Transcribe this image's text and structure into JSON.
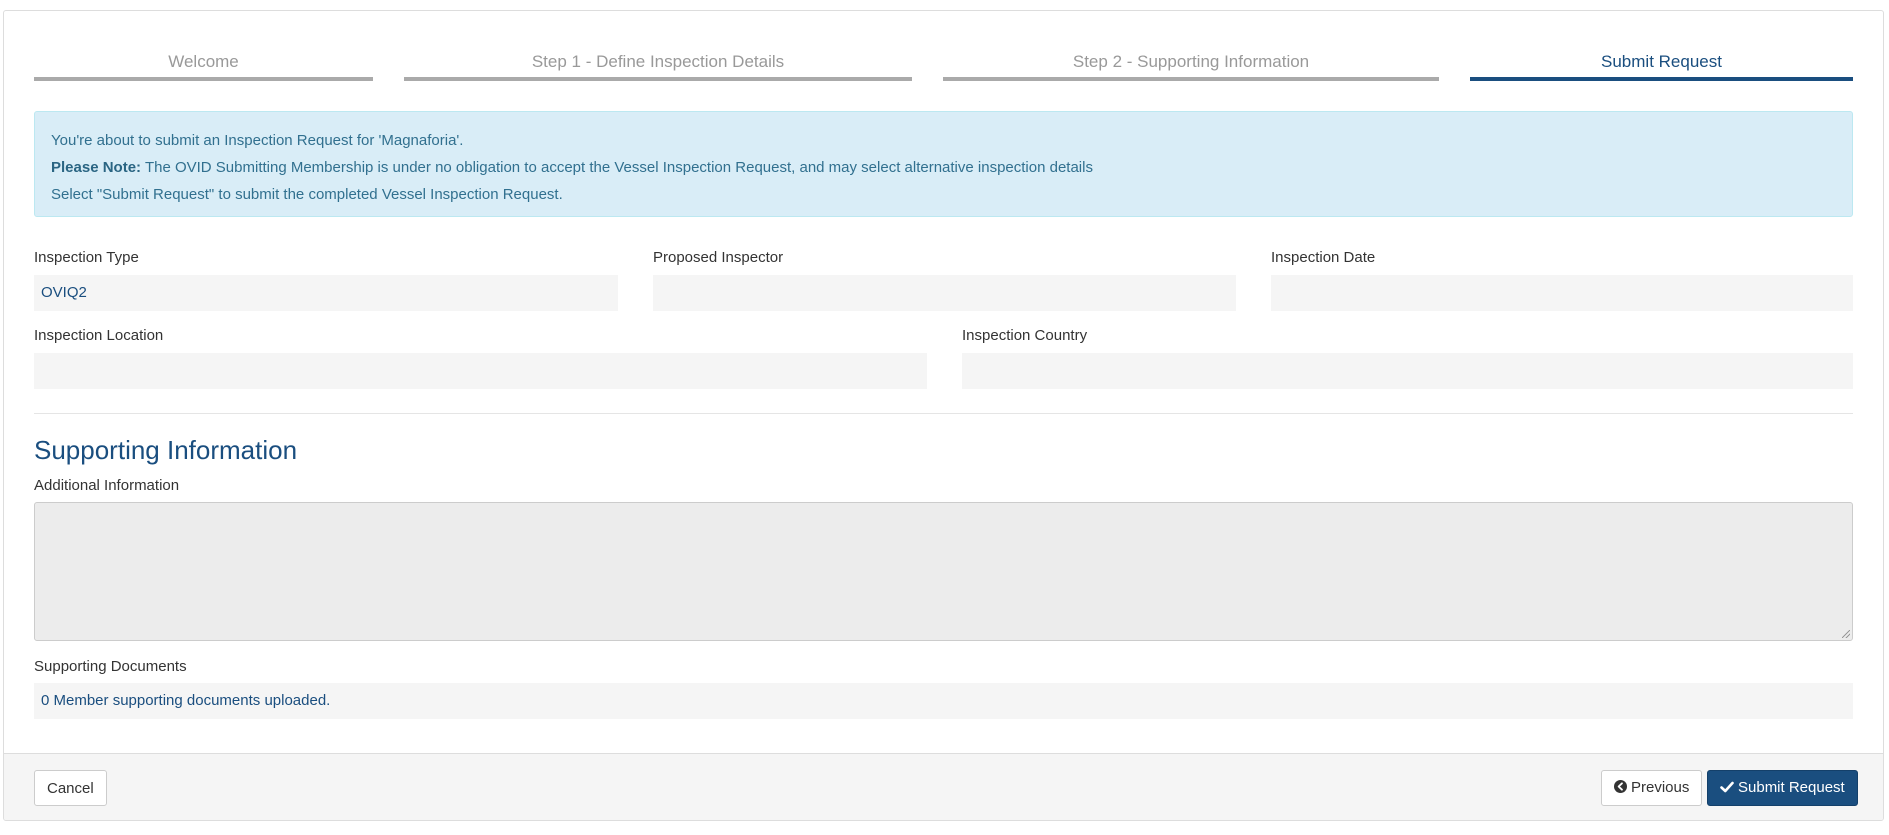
{
  "wizard": {
    "steps": [
      {
        "label": "Welcome",
        "active": false
      },
      {
        "label": "Step 1 - Define Inspection Details",
        "active": false
      },
      {
        "label": "Step 2 - Supporting Information",
        "active": false
      },
      {
        "label": "Submit Request",
        "active": true
      }
    ]
  },
  "alert": {
    "line1": "You're about to submit an Inspection Request for 'Magnaforia'.",
    "note_label": "Please Note:",
    "note_text": " The OVID Submitting Membership is under no obligation to accept the Vessel Inspection Request, and may select alternative inspection details",
    "line3": "Select \"Submit Request\" to submit the completed Vessel Inspection Request."
  },
  "form": {
    "inspection_type": {
      "label": "Inspection Type",
      "value": "OVIQ2"
    },
    "proposed_inspector": {
      "label": "Proposed Inspector",
      "value": ""
    },
    "inspection_date": {
      "label": "Inspection Date",
      "value": ""
    },
    "inspection_location": {
      "label": "Inspection Location",
      "value": ""
    },
    "inspection_country": {
      "label": "Inspection Country",
      "value": ""
    }
  },
  "supporting": {
    "title": "Supporting Information",
    "additional_label": "Additional Information",
    "additional_value": "",
    "documents_label": "Supporting Documents",
    "documents_value": "0 Member supporting documents uploaded."
  },
  "footer": {
    "cancel_label": "Cancel",
    "previous_label": "Previous",
    "submit_label": "Submit Request"
  },
  "icons": {
    "previous": "chevron-circle-left-icon",
    "submit": "check-icon"
  },
  "colors": {
    "accent": "#1a4e7f",
    "alert_bg": "#d9edf7",
    "alert_text": "#31708f",
    "field_bg": "#f5f5f5"
  }
}
